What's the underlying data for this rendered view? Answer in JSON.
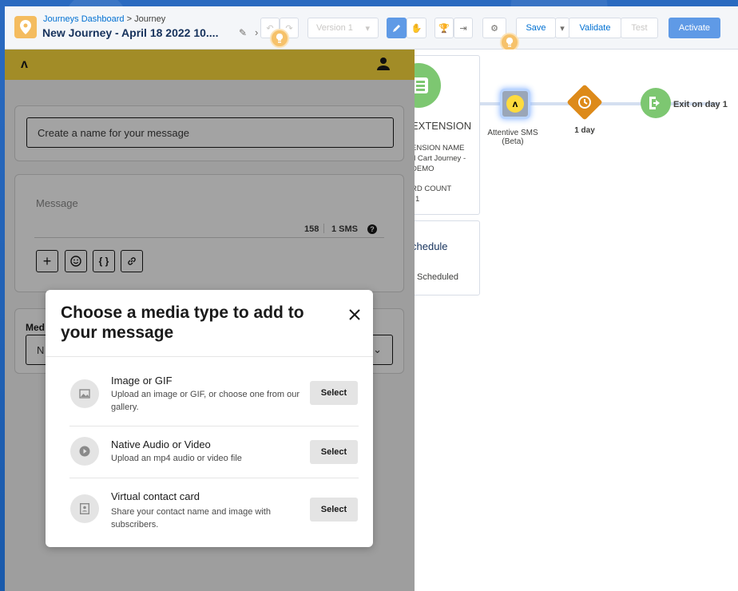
{
  "header": {
    "breadcrumb_link": "Journeys Dashboard",
    "breadcrumb_sep": ">",
    "breadcrumb_current": "Journey",
    "title": "New Journey - April 18 2022 10....",
    "version_label": "Version 1",
    "save_label": "Save",
    "validate_label": "Validate",
    "test_label": "Test",
    "activate_label": "Activate"
  },
  "canvas": {
    "extension_title": "EXTENSION",
    "extension_name_label": "ENSION NAME",
    "extension_name_value": "d Cart Journey -",
    "extension_name_value2": "DEMO",
    "record_count_label": "RD COUNT",
    "record_count_value": "1",
    "schedule_title": "chedule",
    "schedule_status": "Scheduled",
    "sms_node_label": "Attentive SMS (Beta)",
    "wait_label": "1 day",
    "exit_label": "Exit on day 1"
  },
  "panel": {
    "logo": "ʌ",
    "name_placeholder": "Create a name for your message",
    "message_placeholder": "Message",
    "char_count": "158",
    "sms_count": "1 SMS",
    "help": "?",
    "media_label": "Med",
    "media_value": "N"
  },
  "modal": {
    "title": "Choose a media type to add to your message",
    "options": [
      {
        "title": "Image or GIF",
        "desc": "Upload an image or GIF, or choose one from our gallery.",
        "button": "Select",
        "icon": "image-icon"
      },
      {
        "title": "Native Audio or Video",
        "desc": "Upload an mp4 audio or video file",
        "button": "Select",
        "icon": "play-icon"
      },
      {
        "title": "Virtual contact card",
        "desc": "Share your contact name and image with subscribers.",
        "button": "Select",
        "icon": "contact-card-icon"
      }
    ]
  },
  "colors": {
    "brand_yellow": "#fedb3e",
    "salesforce_blue": "#5f9ae6",
    "node_green": "#7dc771",
    "wait_orange": "#dd8a1a"
  }
}
